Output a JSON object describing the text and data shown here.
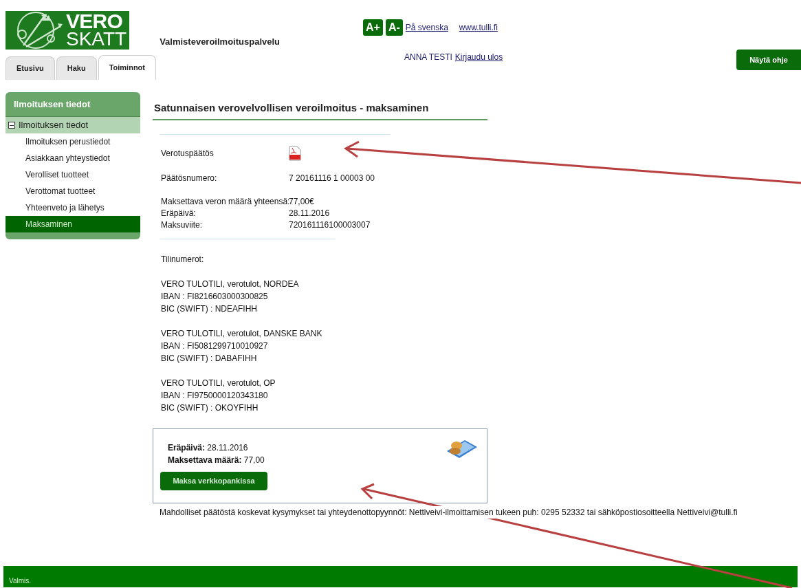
{
  "logo": {
    "line_1": "VERO",
    "line_2": "SKATT"
  },
  "service_title": "Valmisteveroilmoituspalvelu",
  "font_buttons": [
    "A+",
    "A-"
  ],
  "header_links": [
    "På svenska",
    "www.tulli.fi"
  ],
  "user": {
    "name": "ANNA TESTI",
    "logout": "Kirjaudu ulos"
  },
  "help_button": "Näytä ohje",
  "tabs": [
    {
      "label": "Etusivu",
      "selected": false
    },
    {
      "label": "Haku",
      "selected": false
    },
    {
      "label": "Toiminnot",
      "selected": true
    }
  ],
  "sidebar": {
    "title": "Ilmoituksen tiedot",
    "items": [
      {
        "label": "Ilmoituksen tiedot",
        "expanded": true,
        "children": [
          {
            "label": "Ilmoituksen perustiedot",
            "selected": false
          },
          {
            "label": "Asiakkaan yhteystiedot",
            "selected": false
          },
          {
            "label": "Verolliset tuotteet",
            "selected": false
          },
          {
            "label": "Verottomat tuotteet",
            "selected": false
          },
          {
            "label": "Yhteenveto ja lähetys",
            "selected": false
          },
          {
            "label": "Maksaminen",
            "selected": true
          }
        ]
      }
    ]
  },
  "page_title": "Satunnaisen verovelvollisen veroilmoitus - maksaminen",
  "decision": {
    "label": "Verotuspäätös"
  },
  "field_groups": [
    [
      {
        "label": "Päätösnumero:",
        "value": "7 20161116 1 00003 00"
      }
    ],
    [
      {
        "label": "Maksettava veron määrä yhteensä:",
        "value": "77,00€"
      },
      {
        "label": "Eräpäivä:",
        "value": "28.11.2016"
      },
      {
        "label": "Maksuviite:",
        "value": "720161116100003007"
      }
    ]
  ],
  "accounts_title": "Tilinumerot:",
  "accounts": [
    {
      "name": "VERO TULOTILI, verotulot, NORDEA",
      "iban": "IBAN : FI8216603000300825",
      "bic": "BIC (SWIFT) : NDEAFIHH"
    },
    {
      "name": "VERO TULOTILI, verotulot, DANSKE BANK",
      "iban": "IBAN : FI5081299710010927",
      "bic": "BIC (SWIFT) : DABAFIHH"
    },
    {
      "name": "VERO TULOTILI, verotulot, OP",
      "iban": "IBAN : FI9750000120343180",
      "bic": "BIC (SWIFT) : OKOYFIHH"
    }
  ],
  "payment_box": {
    "due": "**Eräpäivä:** 28.11.2016",
    "amount": "**Maksettava määrä:** 77,00",
    "button": "Maksa verkkopankissa"
  },
  "contact_note": "Mahdolliset päätöstä koskevat kysymykset tai yhteydenottopyynnöt: Nettiveivi-ilmoittamisen tukeen puh: 0295 52332 tai sähköpostiosoitteella Nettiveivi@tulli.fi",
  "status_bar": "Valmis."
}
